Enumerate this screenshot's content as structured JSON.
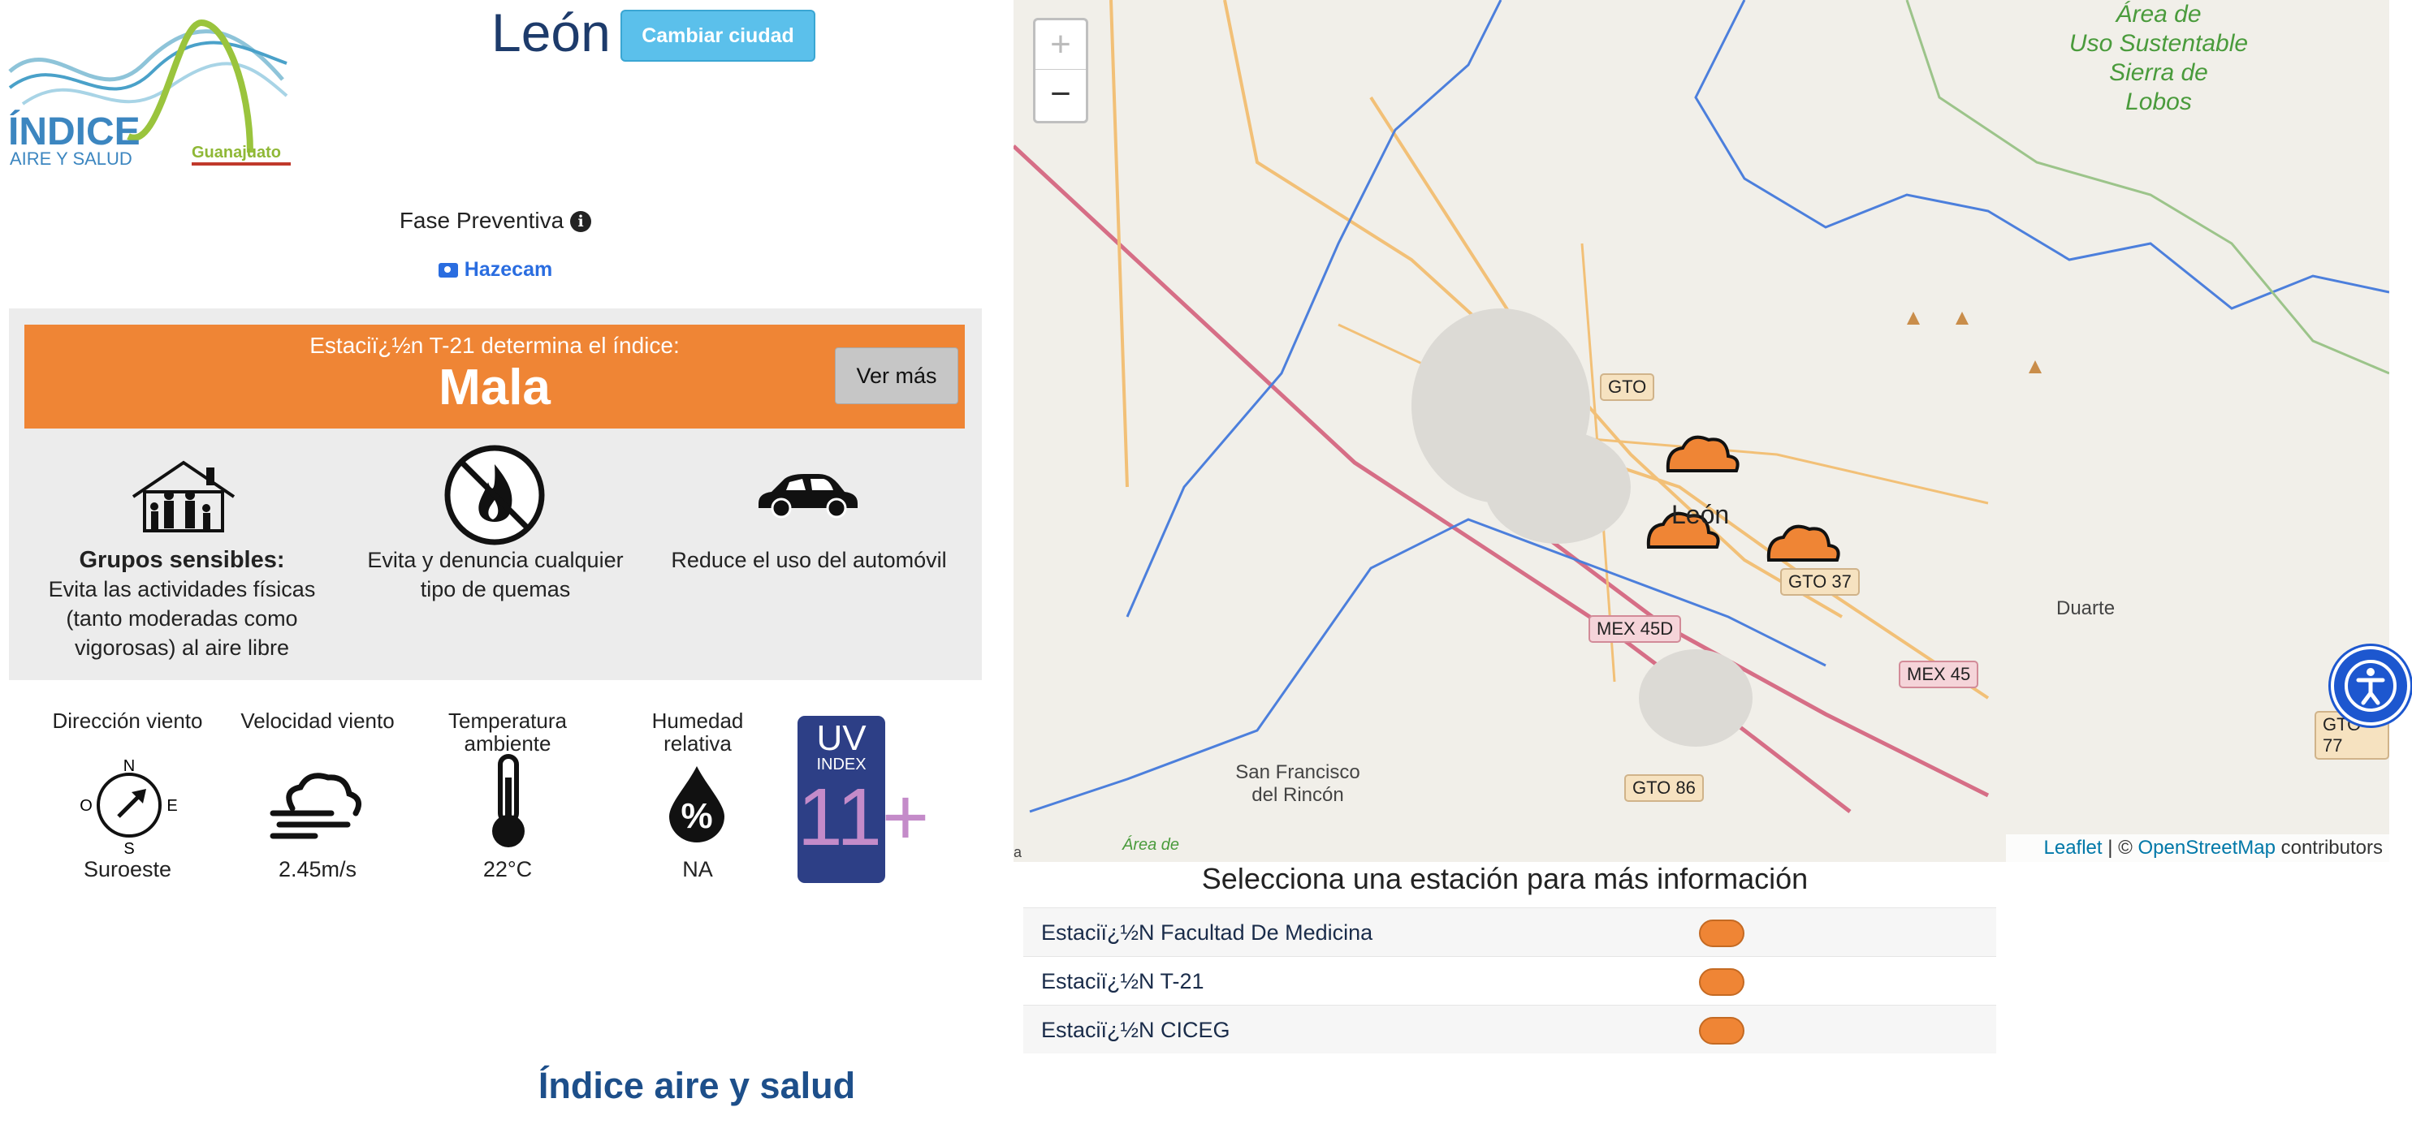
{
  "header": {
    "city": "León",
    "change_city_label": "Cambiar ciudad",
    "logo_title": "ÍNDICE",
    "logo_subtitle": "AIRE Y SALUD",
    "logo_region": "Guanajuato"
  },
  "status": {
    "phase": "Fase Preventiva",
    "hazecam": "Hazecam",
    "determining_text": "Estaciï¿½n T-21 determina el índice:",
    "index_value": "Mala",
    "ver_mas": "Ver más",
    "index_color": "#ef8535"
  },
  "recommendations": [
    {
      "icon": "house-family-icon",
      "title": "Grupos sensibles:",
      "text": "Evita las actividades físicas (tanto moderadas como vigorosas) al aire libre"
    },
    {
      "icon": "no-burning-icon",
      "title": "",
      "text": "Evita y denuncia cualquier tipo de quemas"
    },
    {
      "icon": "car-icon",
      "title": "",
      "text": "Reduce el uso del automóvil"
    }
  ],
  "weather": {
    "wind_dir_label": "Dirección viento",
    "wind_dir_value": "Suroeste",
    "compass": {
      "n": "N",
      "s": "S",
      "e": "E",
      "o": "O"
    },
    "wind_speed_label": "Velocidad viento",
    "wind_speed_value": "2.45m/s",
    "temp_label": "Temperatura ambiente",
    "temp_value": "22°C",
    "humidity_label": "Humedad relativa",
    "humidity_value": "NA",
    "uv_top": "UV",
    "uv_index_label": "INDEX",
    "uv_value": "11+"
  },
  "map": {
    "zoom_in": "+",
    "zoom_out": "−",
    "labels": {
      "area_top_1": "Área de",
      "area_top_2": "Uso Sustentable",
      "area_top_3": "Sierra de",
      "area_top_4": "Lobos",
      "gto": "GTO",
      "leon": "León",
      "gto37": "GTO 37",
      "mex45d": "MEX 45D",
      "mex45": "MEX 45",
      "duarte": "Duarte",
      "gto77": "GTO 77",
      "sanfrancisco1": "San Francisco",
      "sanfrancisco2": "del Rincón",
      "gto86": "GTO 86",
      "area_bottom": "Área de",
      "edge_a": "a"
    },
    "attribution_leaflet": "Leaflet",
    "attribution_sep": "| ©",
    "attribution_osm": "OpenStreetMap",
    "attribution_contrib": "contributors"
  },
  "stations": {
    "title": "Selecciona una estación para más información",
    "items": [
      {
        "name": "Estaciï¿½N Facultad De Medicina",
        "color": "#ef8535"
      },
      {
        "name": "Estaciï¿½N T-21",
        "color": "#ef8535"
      },
      {
        "name": "Estaciï¿½N CICEG",
        "color": "#ef8535"
      }
    ]
  },
  "footer": {
    "title": "Índice aire y salud"
  }
}
